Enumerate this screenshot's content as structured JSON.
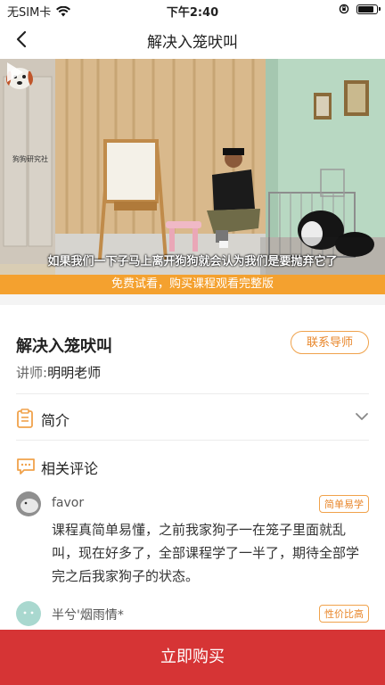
{
  "status_bar": {
    "carrier": "无SIM卡",
    "time": "下午2:40"
  },
  "nav": {
    "title": "解决入笼吠叫"
  },
  "video": {
    "logo_text": "狗狗研究社",
    "subtitle": "如果我们一下子马上离开狗狗就会认为我们是要抛弃它了",
    "trial_notice": "免费试看，购买课程观看完整版"
  },
  "course": {
    "title": "解决入笼吠叫",
    "contact_label": "联系导师",
    "teacher_label": "讲师:",
    "teacher_name": "明明老师"
  },
  "sections": {
    "intro_label": "简介",
    "reviews_label": "相关评论"
  },
  "reviews": [
    {
      "name": "favor",
      "tag": "简单易学",
      "text": "课程真简单易懂，之前我家狗子一在笼子里面就乱叫，现在好多了，全部课程学了一半了，期待全部学完之后我家狗子的状态。"
    },
    {
      "name": "半兮'烟雨情*",
      "tag": "性价比高",
      "text": ""
    }
  ],
  "buy_button": {
    "label": "立即购买"
  },
  "colors": {
    "accent": "#e8862a",
    "trial_bar": "#f4a12f",
    "buy": "#d63435"
  }
}
